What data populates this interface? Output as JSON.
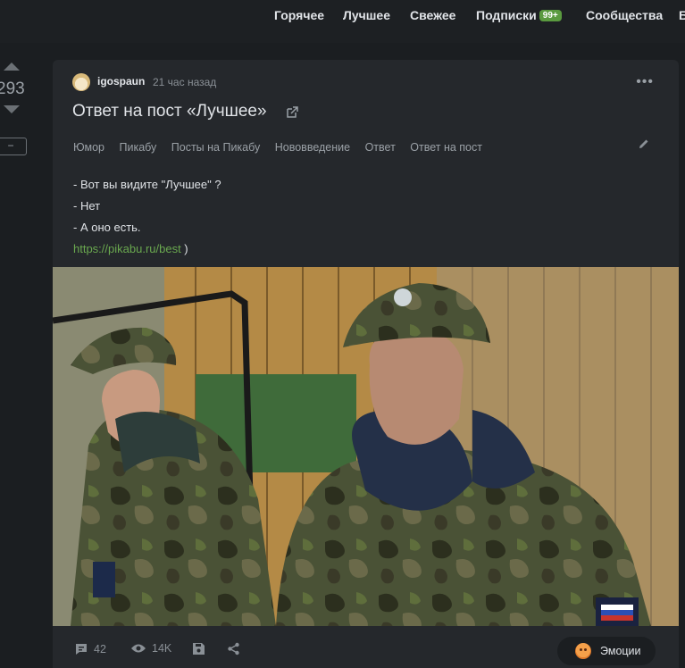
{
  "nav": {
    "hot": "Горячее",
    "best": "Лучшее",
    "fresh": "Свежее",
    "subscriptions": "Подписки",
    "subscriptions_badge": "99+",
    "communities": "Сообщества",
    "cut_off": "Б"
  },
  "vote": {
    "score": "293",
    "collapse_label": "−"
  },
  "story": {
    "author": "igospaun",
    "time": "21 час назад",
    "title": "Ответ на пост «Лучшее»",
    "tags": [
      "Юмор",
      "Пикабу",
      "Посты на Пикабу",
      "Нововведение",
      "Ответ",
      "Ответ на пост"
    ],
    "lines": [
      "- Вот вы видите \"Лучшее\" ?",
      "- Нет",
      "- А оно есть."
    ],
    "link": "https://pikabu.ru/best",
    "link_suffix": " )"
  },
  "footer": {
    "comments": "42",
    "views": "14K",
    "emotions": "Эмоции"
  },
  "colors": {
    "background": "#1d2023",
    "card": "#25282c",
    "accent_green": "#6aa84f",
    "badge_green": "#5a9a3f"
  }
}
